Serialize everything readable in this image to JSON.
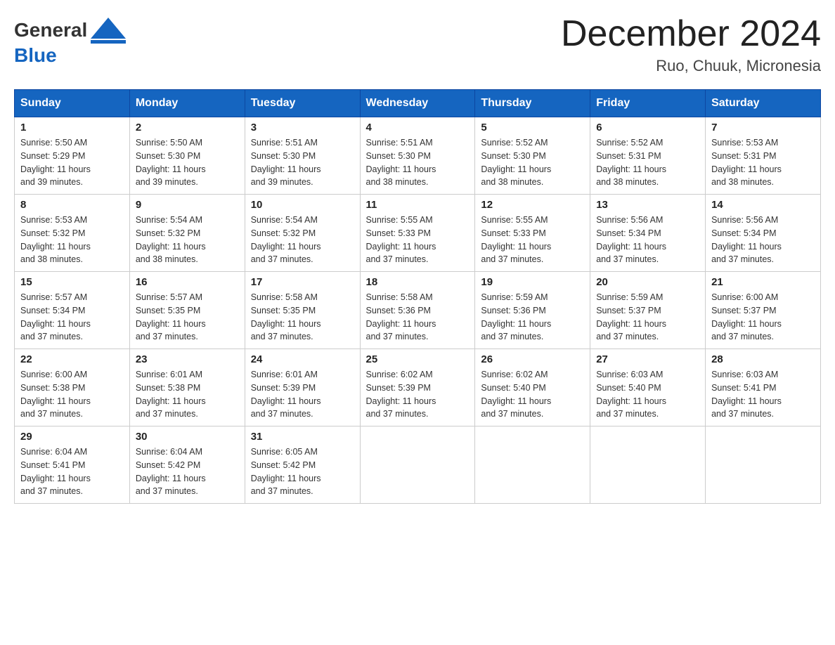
{
  "header": {
    "logo_text_general": "General",
    "logo_text_blue": "Blue",
    "month_title": "December 2024",
    "location": "Ruo, Chuuk, Micronesia"
  },
  "days_of_week": [
    "Sunday",
    "Monday",
    "Tuesday",
    "Wednesday",
    "Thursday",
    "Friday",
    "Saturday"
  ],
  "weeks": [
    [
      {
        "day": "1",
        "sunrise": "5:50 AM",
        "sunset": "5:29 PM",
        "daylight": "11 hours and 39 minutes."
      },
      {
        "day": "2",
        "sunrise": "5:50 AM",
        "sunset": "5:30 PM",
        "daylight": "11 hours and 39 minutes."
      },
      {
        "day": "3",
        "sunrise": "5:51 AM",
        "sunset": "5:30 PM",
        "daylight": "11 hours and 39 minutes."
      },
      {
        "day": "4",
        "sunrise": "5:51 AM",
        "sunset": "5:30 PM",
        "daylight": "11 hours and 38 minutes."
      },
      {
        "day": "5",
        "sunrise": "5:52 AM",
        "sunset": "5:30 PM",
        "daylight": "11 hours and 38 minutes."
      },
      {
        "day": "6",
        "sunrise": "5:52 AM",
        "sunset": "5:31 PM",
        "daylight": "11 hours and 38 minutes."
      },
      {
        "day": "7",
        "sunrise": "5:53 AM",
        "sunset": "5:31 PM",
        "daylight": "11 hours and 38 minutes."
      }
    ],
    [
      {
        "day": "8",
        "sunrise": "5:53 AM",
        "sunset": "5:32 PM",
        "daylight": "11 hours and 38 minutes."
      },
      {
        "day": "9",
        "sunrise": "5:54 AM",
        "sunset": "5:32 PM",
        "daylight": "11 hours and 38 minutes."
      },
      {
        "day": "10",
        "sunrise": "5:54 AM",
        "sunset": "5:32 PM",
        "daylight": "11 hours and 37 minutes."
      },
      {
        "day": "11",
        "sunrise": "5:55 AM",
        "sunset": "5:33 PM",
        "daylight": "11 hours and 37 minutes."
      },
      {
        "day": "12",
        "sunrise": "5:55 AM",
        "sunset": "5:33 PM",
        "daylight": "11 hours and 37 minutes."
      },
      {
        "day": "13",
        "sunrise": "5:56 AM",
        "sunset": "5:34 PM",
        "daylight": "11 hours and 37 minutes."
      },
      {
        "day": "14",
        "sunrise": "5:56 AM",
        "sunset": "5:34 PM",
        "daylight": "11 hours and 37 minutes."
      }
    ],
    [
      {
        "day": "15",
        "sunrise": "5:57 AM",
        "sunset": "5:34 PM",
        "daylight": "11 hours and 37 minutes."
      },
      {
        "day": "16",
        "sunrise": "5:57 AM",
        "sunset": "5:35 PM",
        "daylight": "11 hours and 37 minutes."
      },
      {
        "day": "17",
        "sunrise": "5:58 AM",
        "sunset": "5:35 PM",
        "daylight": "11 hours and 37 minutes."
      },
      {
        "day": "18",
        "sunrise": "5:58 AM",
        "sunset": "5:36 PM",
        "daylight": "11 hours and 37 minutes."
      },
      {
        "day": "19",
        "sunrise": "5:59 AM",
        "sunset": "5:36 PM",
        "daylight": "11 hours and 37 minutes."
      },
      {
        "day": "20",
        "sunrise": "5:59 AM",
        "sunset": "5:37 PM",
        "daylight": "11 hours and 37 minutes."
      },
      {
        "day": "21",
        "sunrise": "6:00 AM",
        "sunset": "5:37 PM",
        "daylight": "11 hours and 37 minutes."
      }
    ],
    [
      {
        "day": "22",
        "sunrise": "6:00 AM",
        "sunset": "5:38 PM",
        "daylight": "11 hours and 37 minutes."
      },
      {
        "day": "23",
        "sunrise": "6:01 AM",
        "sunset": "5:38 PM",
        "daylight": "11 hours and 37 minutes."
      },
      {
        "day": "24",
        "sunrise": "6:01 AM",
        "sunset": "5:39 PM",
        "daylight": "11 hours and 37 minutes."
      },
      {
        "day": "25",
        "sunrise": "6:02 AM",
        "sunset": "5:39 PM",
        "daylight": "11 hours and 37 minutes."
      },
      {
        "day": "26",
        "sunrise": "6:02 AM",
        "sunset": "5:40 PM",
        "daylight": "11 hours and 37 minutes."
      },
      {
        "day": "27",
        "sunrise": "6:03 AM",
        "sunset": "5:40 PM",
        "daylight": "11 hours and 37 minutes."
      },
      {
        "day": "28",
        "sunrise": "6:03 AM",
        "sunset": "5:41 PM",
        "daylight": "11 hours and 37 minutes."
      }
    ],
    [
      {
        "day": "29",
        "sunrise": "6:04 AM",
        "sunset": "5:41 PM",
        "daylight": "11 hours and 37 minutes."
      },
      {
        "day": "30",
        "sunrise": "6:04 AM",
        "sunset": "5:42 PM",
        "daylight": "11 hours and 37 minutes."
      },
      {
        "day": "31",
        "sunrise": "6:05 AM",
        "sunset": "5:42 PM",
        "daylight": "11 hours and 37 minutes."
      },
      null,
      null,
      null,
      null
    ]
  ],
  "labels": {
    "sunrise_prefix": "Sunrise: ",
    "sunset_prefix": "Sunset: ",
    "daylight_prefix": "Daylight: "
  }
}
